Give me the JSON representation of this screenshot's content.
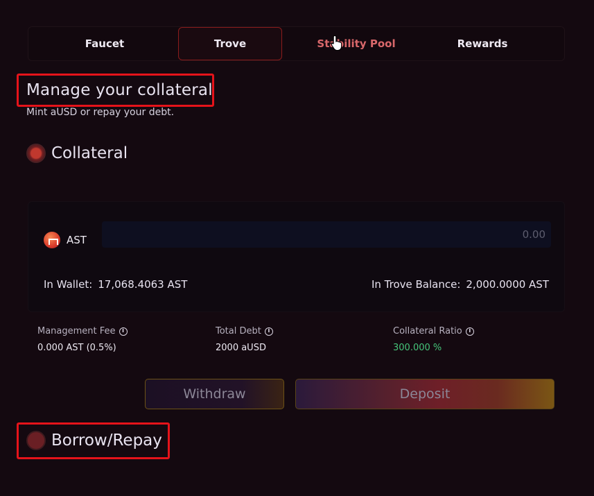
{
  "tabs": [
    {
      "label": "Faucet",
      "active": false
    },
    {
      "label": "Trove",
      "active": true
    },
    {
      "label": "Stability Pool",
      "active": false
    },
    {
      "label": "Rewards",
      "active": false
    }
  ],
  "header": {
    "title": "Manage your collateral",
    "subtitle": "Mint aUSD or repay your debt."
  },
  "collateral": {
    "heading": "Collateral",
    "token_label": "AST",
    "amount_placeholder": "0.00",
    "wallet_label": "In Wallet:",
    "wallet_value": "17,068.4063 AST",
    "trove_balance_label": "In Trove Balance:",
    "trove_balance_value": "2,000.0000 AST"
  },
  "stats": {
    "management_fee_label": "Management Fee",
    "management_fee_value": "0.000 AST (0.5%)",
    "total_debt_label": "Total Debt",
    "total_debt_value": "2000 aUSD",
    "collateral_ratio_label": "Collateral Ratio",
    "collateral_ratio_value": "300.000 %"
  },
  "actions": {
    "withdraw_label": "Withdraw",
    "deposit_label": "Deposit"
  },
  "borrow": {
    "heading": "Borrow/Repay"
  },
  "icons": {
    "info": "info-icon",
    "token": "ast-token-icon",
    "cursor": "hand-pointer-icon"
  },
  "colors": {
    "accent_red": "#e5131a",
    "ratio_green": "#45c57a",
    "hover_tab": "#d9686b"
  }
}
